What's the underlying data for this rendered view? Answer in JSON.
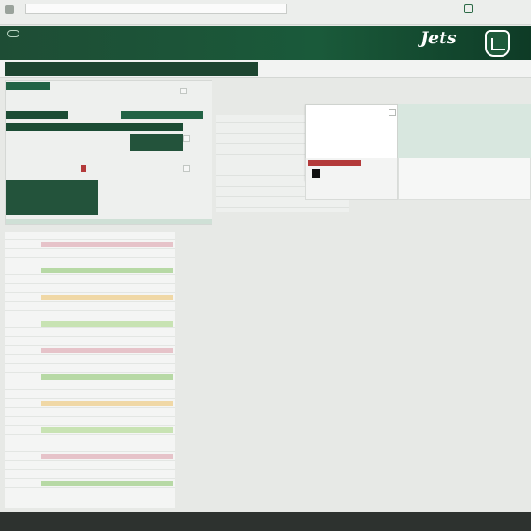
{
  "browser": {
    "url": "",
    "top_links": [
      "",
      ""
    ],
    "tabs": [
      "",
      "",
      "",
      "",
      "",
      "",
      "",
      ""
    ]
  },
  "header": {
    "wordmark": "Jets",
    "subtitle": "",
    "links": [
      "",
      "",
      "",
      "",
      "",
      "",
      "",
      "",
      "",
      ""
    ]
  },
  "subnav": {
    "items": [
      "",
      "",
      "",
      "",
      "",
      "",
      "",
      "",
      "",
      "",
      ""
    ]
  },
  "left_panel": {
    "lines": [
      "",
      "",
      "",
      "",
      "",
      "",
      "",
      "",
      "",
      "",
      ""
    ],
    "buttons": [
      "",
      "",
      ""
    ],
    "red_button": ""
  },
  "middle_table": {
    "rows": [
      [
        "",
        ""
      ],
      [
        "",
        ""
      ],
      [
        "",
        ""
      ],
      [
        "",
        ""
      ],
      [
        "",
        ""
      ],
      [
        "",
        ""
      ],
      [
        "",
        ""
      ],
      [
        "",
        ""
      ],
      [
        "",
        ""
      ],
      [
        "",
        ""
      ],
      [
        "",
        ""
      ]
    ]
  },
  "popup": {
    "lines": [
      "",
      "",
      "",
      "",
      ""
    ],
    "red_button": ""
  },
  "right_panel": {
    "lines": [
      "",
      "",
      "",
      "",
      "",
      ""
    ]
  },
  "list": {
    "rows": [
      [
        "",
        "",
        ""
      ],
      [
        "",
        "",
        ""
      ],
      [
        "",
        "",
        ""
      ],
      [
        "",
        "",
        ""
      ],
      [
        "",
        "",
        ""
      ],
      [
        "",
        "",
        ""
      ],
      [
        "",
        "",
        ""
      ],
      [
        "",
        "",
        ""
      ],
      [
        "",
        "",
        ""
      ],
      [
        "",
        "",
        ""
      ],
      [
        "",
        "",
        ""
      ],
      [
        "",
        "",
        ""
      ],
      [
        "",
        "",
        ""
      ],
      [
        "",
        "",
        ""
      ],
      [
        "",
        "",
        ""
      ],
      [
        "",
        "",
        ""
      ],
      [
        "",
        "",
        ""
      ],
      [
        "",
        "",
        ""
      ],
      [
        "",
        "",
        ""
      ],
      [
        "",
        "",
        ""
      ],
      [
        "",
        "",
        ""
      ],
      [
        "",
        "",
        ""
      ],
      [
        "",
        "",
        ""
      ],
      [
        "",
        "",
        ""
      ],
      [
        "",
        "",
        ""
      ],
      [
        "",
        "",
        ""
      ],
      [
        "",
        "",
        ""
      ],
      [
        "",
        "",
        ""
      ],
      [
        "",
        "",
        ""
      ],
      [
        "",
        "",
        ""
      ]
    ],
    "highlight_colors": [
      "#b7d9a5",
      "#e6c3c9",
      "#c8e3b3",
      "#f0d8a6"
    ]
  },
  "footer": {
    "items": [
      "",
      "",
      "",
      "",
      "",
      ""
    ]
  },
  "colors": {
    "brand_green": "#1e4d35",
    "accent_red": "#b33a3a"
  }
}
